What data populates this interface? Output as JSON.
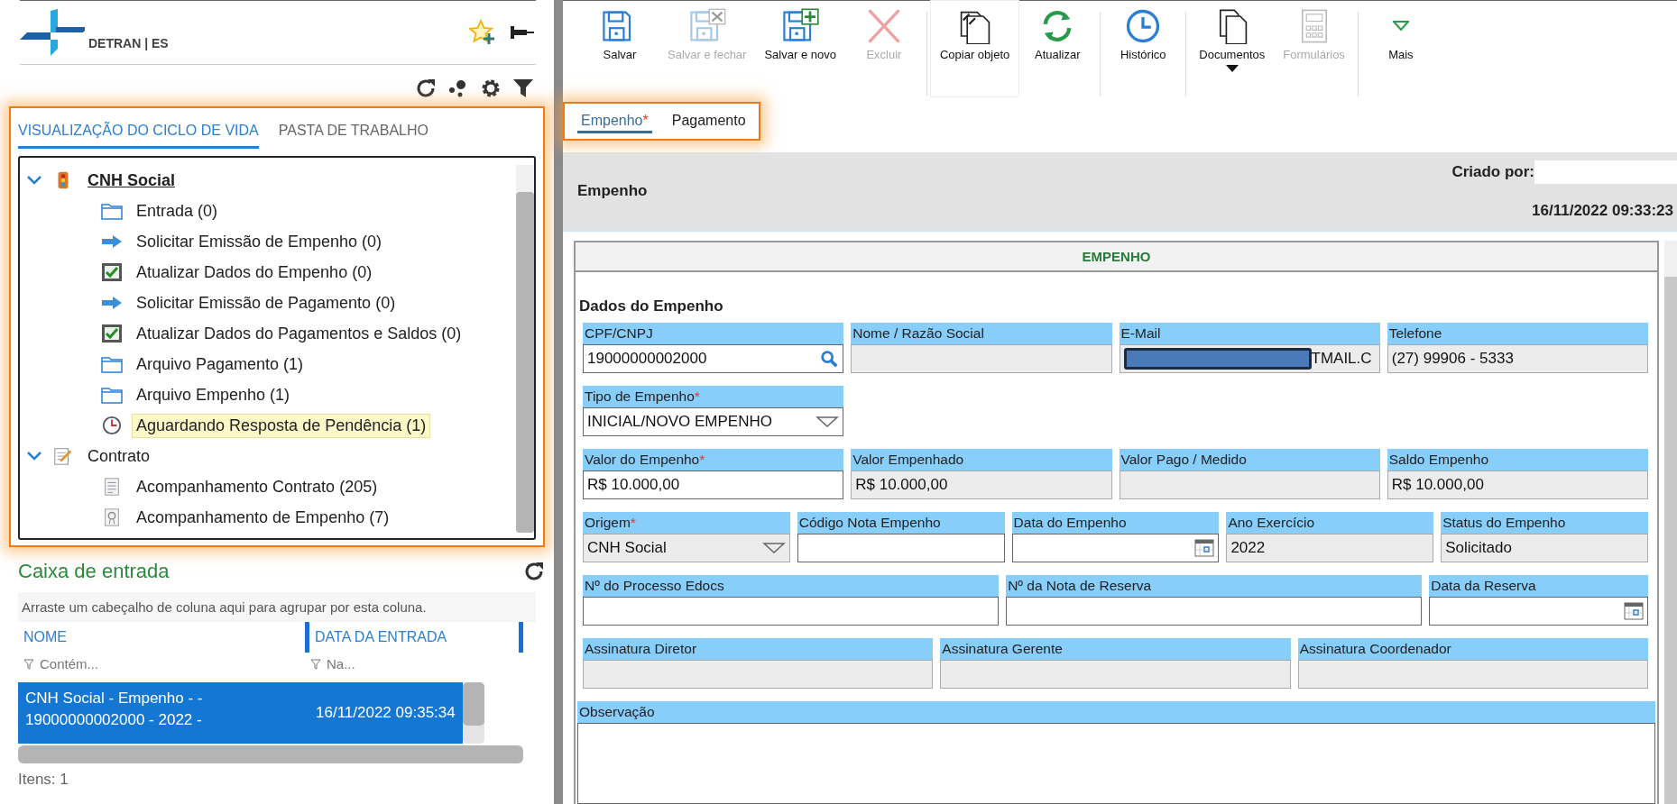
{
  "sidebar": {
    "logo": {
      "text": "DETRAN | ES"
    },
    "lifecycle": {
      "highlighted": true,
      "tabs": [
        {
          "label": "VISUALIZAÇÃO DO CICLO DE VIDA",
          "selected": true
        },
        {
          "label": "PASTA DE TRABALHO",
          "selected": false
        }
      ],
      "tree": [
        {
          "label": "CNH Social",
          "kind": "traffic-light",
          "expanded": true,
          "selected": true,
          "children": [
            {
              "label": "Entrada (0)",
              "kind": "folder",
              "selected": false
            },
            {
              "label": "Solicitar Emissão de Empenho (0)",
              "kind": "arrow",
              "selected": false
            },
            {
              "label": "Atualizar Dados do Empenho (0)",
              "kind": "check",
              "selected": false
            },
            {
              "label": "Solicitar Emissão de Pagamento (0)",
              "kind": "arrow",
              "selected": false
            },
            {
              "label": "Atualizar Dados do Pagamentos e Saldos (0)",
              "kind": "check",
              "selected": false
            },
            {
              "label": "Arquivo Pagamento (1)",
              "kind": "folder",
              "selected": false
            },
            {
              "label": "Arquivo Empenho (1)",
              "kind": "folder",
              "selected": false
            },
            {
              "label": "Aguardando Resposta de Pendência (1)",
              "kind": "clock",
              "selected": true
            }
          ]
        },
        {
          "label": "Contrato",
          "kind": "contract",
          "expanded": true,
          "selected": false,
          "children": [
            {
              "label": "Acompanhamento Contrato (205)",
              "kind": "document",
              "selected": false
            },
            {
              "label": "Acompanhamento de Empenho (7)",
              "kind": "certificate",
              "selected": false
            }
          ]
        }
      ]
    },
    "inbox": {
      "title": "Caixa de entrada",
      "group_hint": "Arraste um cabeçalho de coluna aqui para agrupar por esta coluna.",
      "columns": [
        {
          "label": "NOME",
          "filter_placeholder": "Contém..."
        },
        {
          "label": "DATA DA ENTRADA",
          "filter_placeholder": "Na..."
        }
      ],
      "rows": [
        {
          "cells": [
            "CNH Social - Empenho - - 19000000002000 - 2022 -",
            "16/11/2022 09:35:34"
          ],
          "selected": true
        }
      ],
      "footer": "Itens: 1"
    }
  },
  "toolbar": [
    {
      "label": "Salvar",
      "kind": "save",
      "disabled": false,
      "selected": false,
      "has_menu": false
    },
    {
      "label": "Salvar e fechar",
      "kind": "save-close",
      "disabled": true,
      "selected": false,
      "has_menu": false
    },
    {
      "label": "Salvar e novo",
      "kind": "save-new",
      "disabled": false,
      "selected": false,
      "has_menu": false
    },
    {
      "label": "Excluir",
      "kind": "delete",
      "disabled": true,
      "selected": false,
      "has_menu": false
    },
    {
      "label": "Copiar objeto",
      "kind": "copy",
      "disabled": false,
      "selected": true,
      "has_menu": false
    },
    {
      "label": "Atualizar",
      "kind": "refresh",
      "disabled": false,
      "selected": false,
      "has_menu": false
    },
    {
      "label": "Histórico",
      "kind": "history",
      "disabled": false,
      "selected": false,
      "has_menu": false
    },
    {
      "label": "Documentos",
      "kind": "documents",
      "disabled": false,
      "selected": false,
      "has_menu": true
    },
    {
      "label": "Formulários",
      "kind": "forms",
      "disabled": true,
      "selected": false,
      "has_menu": false
    },
    {
      "label": "Mais",
      "kind": "more",
      "disabled": false,
      "selected": false,
      "has_menu": false
    }
  ],
  "record_tabs": {
    "highlighted": true,
    "tabs": [
      {
        "label": "Empenho",
        "flag": "*",
        "selected": true
      },
      {
        "label": "Pagamento",
        "selected": false
      }
    ]
  },
  "header": {
    "title": "Empenho",
    "created_by_label": "Criado por:",
    "created_at": "16/11/2022 09:33:23"
  },
  "form": {
    "section_title": "EMPENHO",
    "group_title": "Dados do Empenho",
    "rows": [
      [
        {
          "label": "CPF/CNPJ",
          "kind": "search",
          "value": "19000000002000",
          "required": false
        },
        {
          "label": "Nome / Razão Social",
          "kind": "readonly",
          "required": false
        },
        {
          "label": "E-Mail",
          "kind": "redacted",
          "value": "TMAIL.C",
          "required": false
        },
        {
          "label": "Telefone",
          "kind": "readonly",
          "value": "(27) 99906 - 5333",
          "required": false
        }
      ],
      [
        {
          "label": "Tipo de Empenho",
          "kind": "select",
          "value": "INICIAL/NOVO EMPENHO",
          "required": true
        }
      ],
      [
        {
          "label": "Valor do Empenho",
          "kind": "input",
          "value": "R$ 10.000,00",
          "required": true
        },
        {
          "label": "Valor Empenhado",
          "kind": "readonly",
          "value": "R$ 10.000,00",
          "required": false
        },
        {
          "label": "Valor Pago / Medido",
          "kind": "readonly",
          "required": false
        },
        {
          "label": "Saldo Empenho",
          "kind": "readonly",
          "value": "R$ 10.000,00",
          "required": false
        }
      ],
      [
        {
          "label": "Origem",
          "kind": "readonly-select",
          "value": "CNH Social",
          "required": true
        },
        {
          "label": "Código Nota Empenho",
          "kind": "input",
          "required": false
        },
        {
          "label": "Data do Empenho",
          "kind": "date",
          "required": false
        },
        {
          "label": "Ano Exercício",
          "kind": "readonly",
          "value": "2022",
          "required": false
        },
        {
          "label": "Status do Empenho",
          "kind": "readonly",
          "value": "Solicitado",
          "required": false
        }
      ],
      [
        {
          "label": "Nº do Processo Edocs",
          "kind": "input",
          "required": false
        },
        {
          "label": "Nº da Nota de Reserva",
          "kind": "input",
          "required": false
        },
        {
          "label": "Data da Reserva",
          "kind": "date",
          "required": false
        }
      ],
      [
        {
          "label": "Assinatura Diretor",
          "kind": "readonly",
          "required": false
        },
        {
          "label": "Assinatura Gerente",
          "kind": "readonly",
          "required": false
        },
        {
          "label": "Assinatura Coordenador",
          "kind": "readonly",
          "required": false
        }
      ],
      [
        {
          "label": "Observação",
          "kind": "textarea",
          "required": false
        }
      ]
    ]
  }
}
